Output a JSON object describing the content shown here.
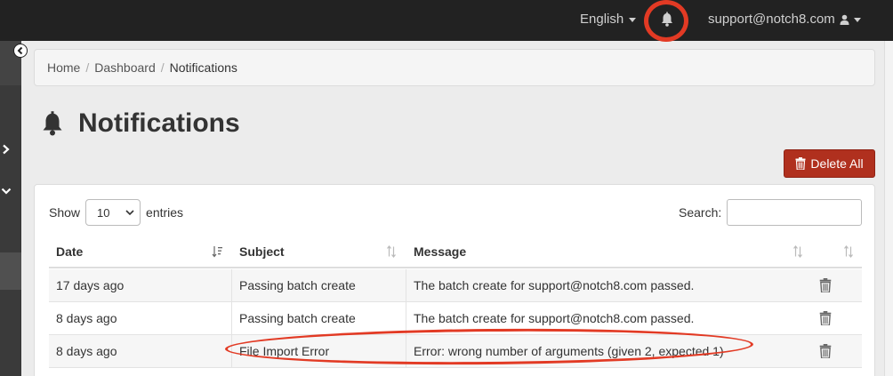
{
  "nav": {
    "language": "English",
    "user": "support@notch8.com",
    "bell_icon": "bell-icon",
    "highlight_color": "#e23a24"
  },
  "breadcrumb": {
    "items": [
      "Home",
      "Dashboard"
    ],
    "active": "Notifications",
    "separator": "/"
  },
  "page": {
    "title": "Notifications",
    "delete_all": "Delete All",
    "delete_color": "#b0301e"
  },
  "table_controls": {
    "show_label": "Show",
    "entries_value": "10",
    "entries_label": "entries",
    "search_label": "Search:",
    "search_value": ""
  },
  "table": {
    "headers": [
      "Date",
      "Subject",
      "Message"
    ],
    "rows": [
      {
        "date": "17 days ago",
        "subject": "Passing batch create",
        "message": "The batch create for support@notch8.com passed."
      },
      {
        "date": "8 days ago",
        "subject": "Passing batch create",
        "message": "The batch create for support@notch8.com passed."
      },
      {
        "date": "8 days ago",
        "subject": "File Import Error",
        "message": "Error: wrong number of arguments (given 2, expected 1)"
      }
    ]
  }
}
